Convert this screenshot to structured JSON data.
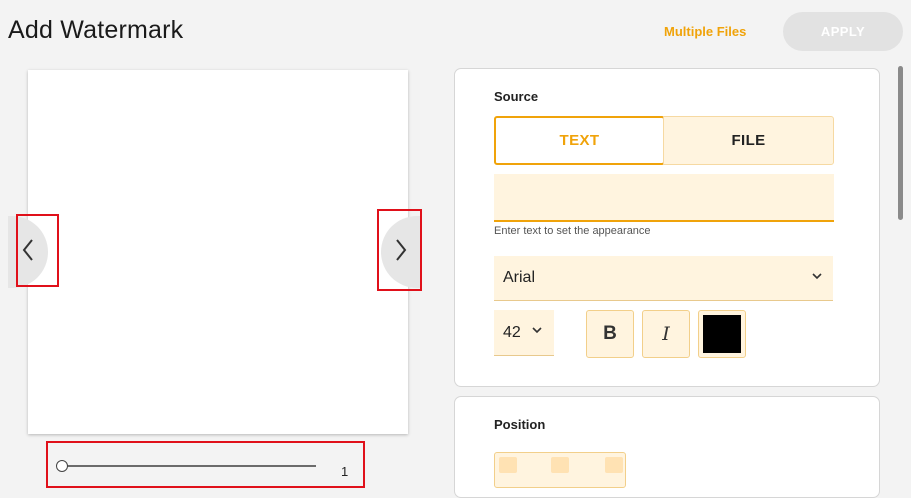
{
  "header": {
    "title": "Add Watermark",
    "multiple_files": "Multiple Files",
    "apply": "APPLY"
  },
  "preview": {
    "page_number": "1",
    "prev_icon": "chevron-left-icon",
    "next_icon": "chevron-right-icon"
  },
  "source": {
    "label": "Source",
    "tabs": [
      "TEXT",
      "FILE"
    ],
    "active_tab": "TEXT",
    "text_value": "",
    "hint": "Enter text to set the appearance",
    "font": "Arial",
    "size": "42",
    "bold": "B",
    "italic": "I",
    "color": "#000000"
  },
  "position": {
    "label": "Position"
  },
  "colors": {
    "accent": "#f0a30a",
    "field_bg": "#fff4df",
    "highlight": "#e0101a"
  }
}
